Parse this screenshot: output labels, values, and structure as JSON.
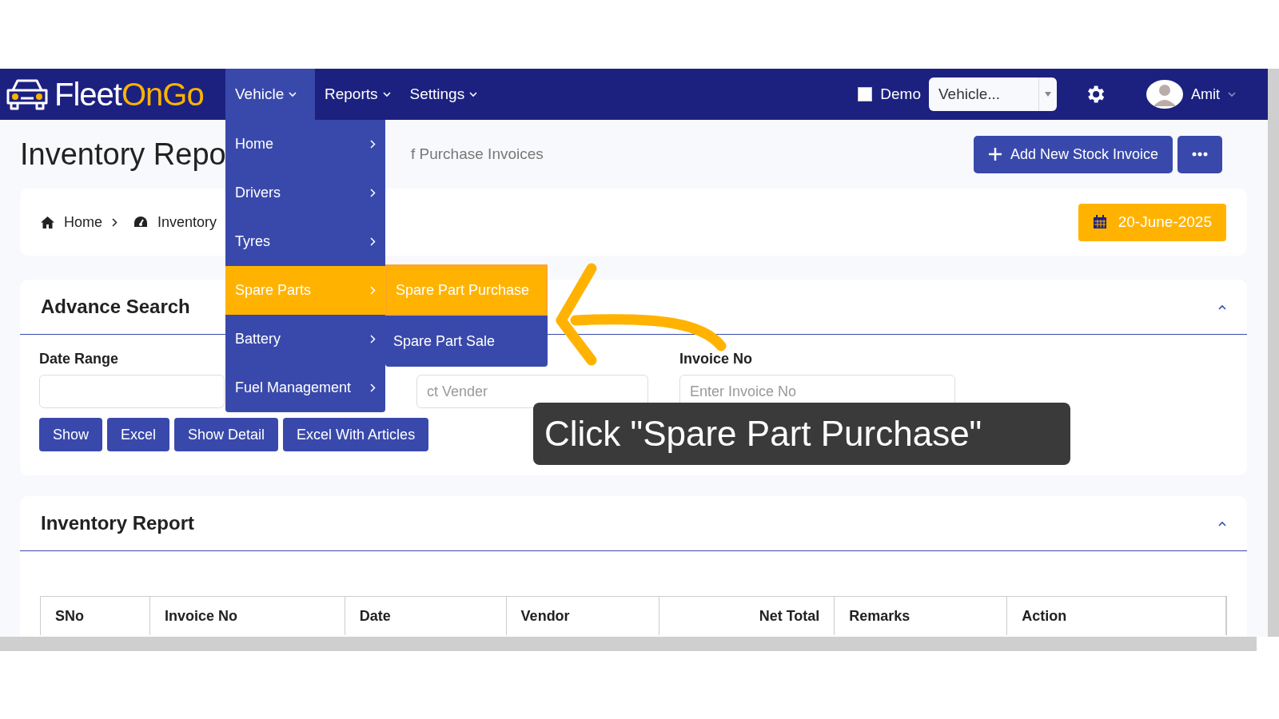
{
  "navbar": {
    "logo": {
      "part1": "Fleet",
      "part2": "OnGo"
    },
    "menus": [
      {
        "label": "Vehicle",
        "selected": true
      },
      {
        "label": "Reports",
        "selected": false
      },
      {
        "label": "Settings",
        "selected": false
      }
    ],
    "demo": {
      "label": "Demo",
      "checked": false
    },
    "vehicle_select": {
      "value": "Vehicle..."
    },
    "user": {
      "name": "Amit"
    }
  },
  "vehicle_menu": {
    "items": [
      {
        "label": "Home",
        "selected": false
      },
      {
        "label": "Drivers",
        "selected": false
      },
      {
        "label": "Tyres",
        "selected": false
      },
      {
        "label": "Spare Parts",
        "selected": true
      },
      {
        "label": "Battery",
        "selected": false
      },
      {
        "label": "Fuel Management",
        "selected": false
      }
    ],
    "submenu": [
      {
        "label": "Spare Part Purchase",
        "selected": true
      },
      {
        "label": "Spare Part Sale",
        "selected": false
      }
    ]
  },
  "header": {
    "title": "Inventory Repo",
    "subtitle": "f Purchase Invoices",
    "add_button": "Add New Stock Invoice"
  },
  "breadcrumb": {
    "items": [
      "Home",
      "Inventory"
    ],
    "date": "20-June-2025"
  },
  "advance_search": {
    "title": "Advance Search",
    "fields": [
      {
        "label": "Date Range"
      },
      {
        "placeholder": "ct Vender"
      },
      {
        "label": "Invoice No",
        "placeholder": "Enter Invoice No"
      }
    ],
    "buttons": [
      "Show",
      "Excel",
      "Show Detail",
      "Excel With Articles"
    ]
  },
  "inventory_report": {
    "title": "Inventory Report",
    "columns": [
      "SNo",
      "Invoice No",
      "Date",
      "Vendor",
      "Net Total",
      "Remarks",
      "Action"
    ]
  },
  "callout": {
    "text": "Click \"Spare Part Purchase\""
  }
}
